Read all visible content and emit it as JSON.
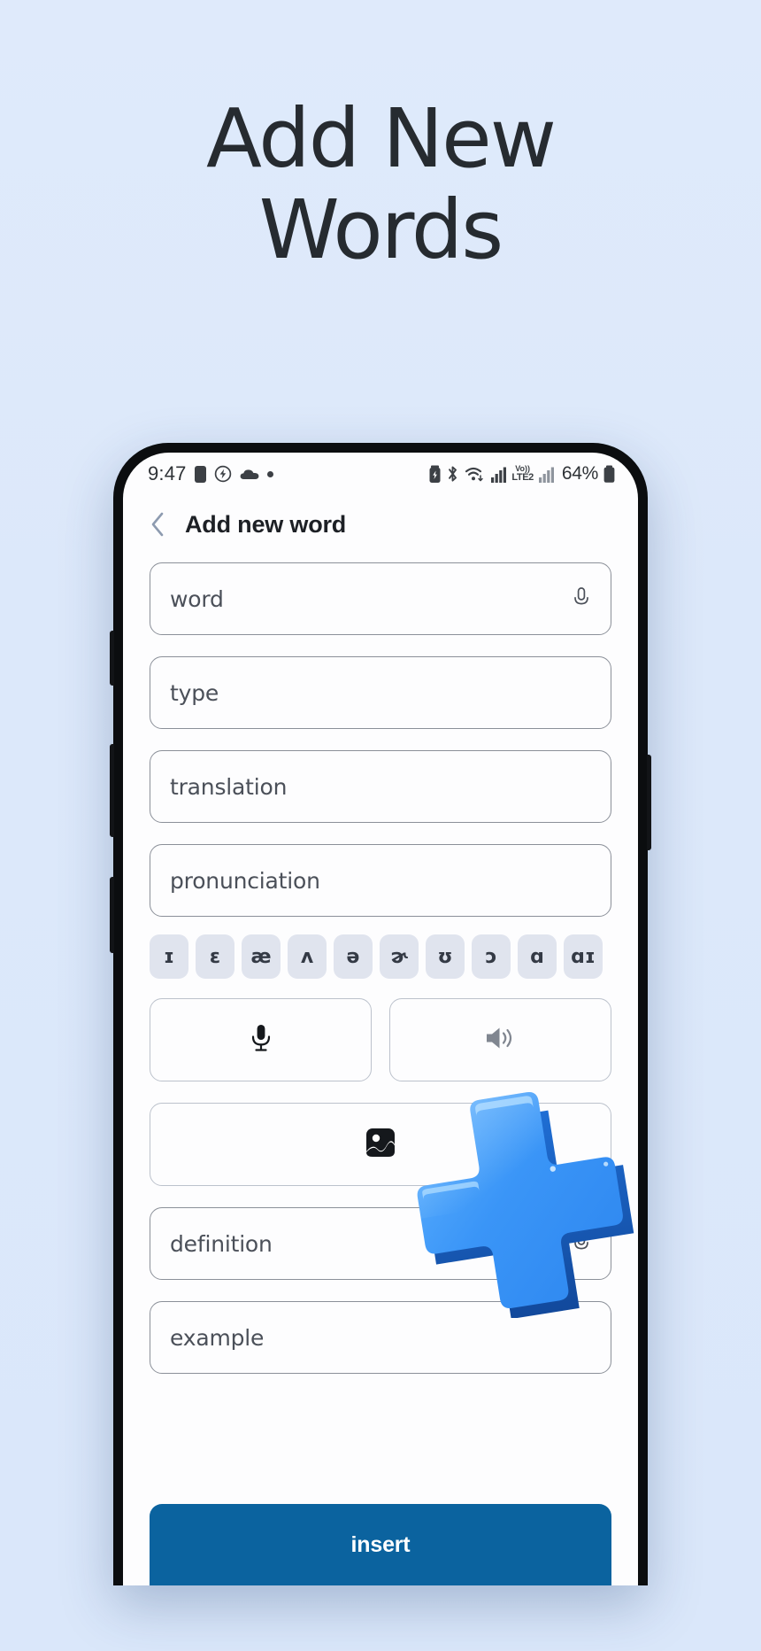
{
  "promo": {
    "headline_line1": "Add New",
    "headline_line2": "Words",
    "background_color": "#dce8fa",
    "headline_color": "#262b30",
    "graphic": "plus-3d-icon"
  },
  "phone": {
    "statusbar": {
      "time": "9:47",
      "left_icons": [
        "sim-card-icon",
        "charging-bolt-icon",
        "cloud-icon",
        "dot-icon"
      ],
      "right_icons": [
        "battery-saver-icon",
        "bluetooth-icon",
        "wifi-icon",
        "signal-bars-icon",
        "volte-icon",
        "signal-bars-2-icon",
        "battery-icon"
      ],
      "volte_top": "Vo))",
      "volte_bottom": "LTE2",
      "battery_percent": "64%"
    },
    "appbar": {
      "back_icon": "chevron-left-icon",
      "title": "Add new word"
    },
    "fields": [
      {
        "name": "word",
        "placeholder": "word",
        "trailing_icon": "microphone-icon"
      },
      {
        "name": "type",
        "placeholder": "type",
        "trailing_icon": ""
      },
      {
        "name": "translation",
        "placeholder": "translation",
        "trailing_icon": ""
      },
      {
        "name": "pronunciation",
        "placeholder": "pronunciation",
        "trailing_icon": ""
      }
    ],
    "ipa_keys": [
      "ɪ",
      "ɛ",
      "æ",
      "ʌ",
      "ə",
      "ɚ",
      "ʊ",
      "ɔ",
      "ɑ",
      "ɑɪ"
    ],
    "media_buttons": [
      {
        "name": "record-audio",
        "icon": "microphone-icon"
      },
      {
        "name": "play-audio",
        "icon": "speaker-icon"
      }
    ],
    "image_button": {
      "name": "pick-image",
      "icon": "image-icon"
    },
    "bottom_fields": [
      {
        "name": "definition",
        "placeholder": "definition",
        "trailing_icon": "microphone-icon"
      },
      {
        "name": "example",
        "placeholder": "example",
        "trailing_icon": ""
      }
    ],
    "submit": {
      "label": "insert",
      "color": "#0b639f",
      "text_color": "#ffffff"
    }
  }
}
